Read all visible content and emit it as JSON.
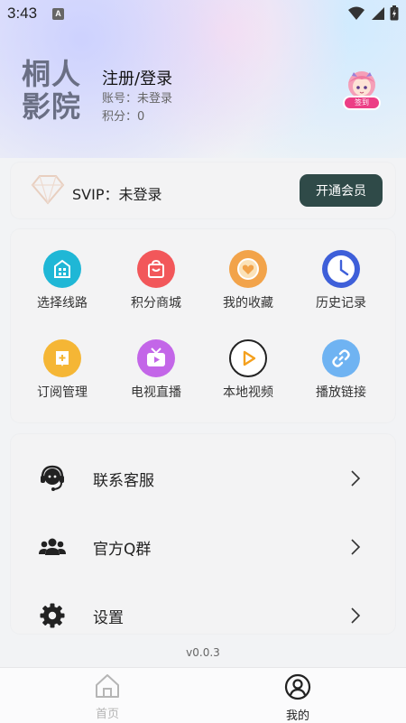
{
  "status_bar": {
    "time": "3:43",
    "notification_badge": "A"
  },
  "profile": {
    "logo_text_line1": "桐人",
    "logo_text_line2": "影院",
    "title": "注册/登录",
    "account": "账号：未登录",
    "points": "积分：0",
    "checkin_label": "签到"
  },
  "vip": {
    "text": "SVIP：未登录",
    "button": "开通会员"
  },
  "grid": [
    {
      "label": "选择线路",
      "icon": "building-icon",
      "color": "#1fb7d6"
    },
    {
      "label": "积分商城",
      "icon": "shopping-bag-icon",
      "color": "#f2575a"
    },
    {
      "label": "我的收藏",
      "icon": "heart-icon",
      "color": "#f2a34a"
    },
    {
      "label": "历史记录",
      "icon": "clock-icon",
      "color": "#3e5fd9"
    },
    {
      "label": "订阅管理",
      "icon": "subscribe-icon",
      "color": "#f5b635"
    },
    {
      "label": "电视直播",
      "icon": "tv-icon",
      "color": "#c366e8"
    },
    {
      "label": "本地视频",
      "icon": "play-icon",
      "color": "#f4a01d"
    },
    {
      "label": "播放链接",
      "icon": "link-icon",
      "color": "#6fb3f2"
    }
  ],
  "menu": [
    {
      "label": "联系客服",
      "icon": "headset-icon"
    },
    {
      "label": "官方Q群",
      "icon": "group-icon"
    },
    {
      "label": "设置",
      "icon": "gear-icon"
    }
  ],
  "version": "v0.0.3",
  "nav": {
    "home": "首页",
    "mine": "我的",
    "active_color": "#222222",
    "inactive_color": "#b5b5b5"
  }
}
